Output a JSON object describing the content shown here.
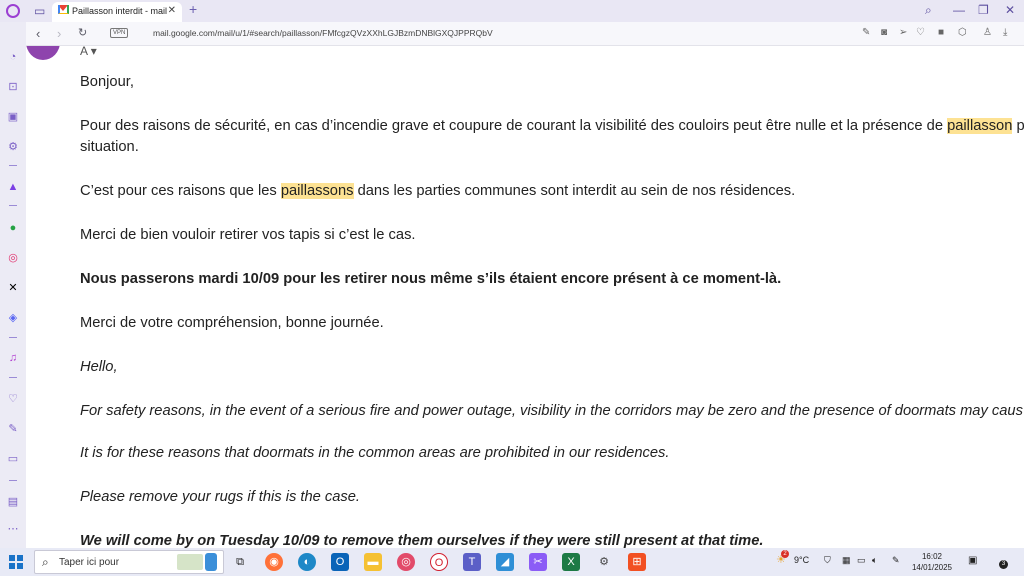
{
  "browser": {
    "tab_title": "Paillasson interdit - mail go",
    "new_tab_symbol": "+",
    "tab_close_symbol": "✕",
    "url": "mail.google.com/mail/u/1/#search/paillasson/FMfcgzQVzXXhLGJBzmDNBlGXQJPPRQbV",
    "vpn_label": "VPN"
  },
  "email": {
    "sender_initial": "A",
    "greeting": "Bonjour,",
    "p1_before": "Pour des raisons de sécurité, en cas d’incendie grave et coupure de courant la visibilité des couloirs peut être nulle et la présence de ",
    "p1_highlight": "paillasson",
    "p1_after": " p",
    "p1_line2": "situation.",
    "p2_before": "C’est pour ces raisons que les ",
    "p2_highlight": "paillassons",
    "p2_after": " dans les parties communes sont interdit au sein de nos résidences.",
    "p3": "Merci de bien vouloir retirer vos tapis si c’est le cas.",
    "p4": "Nous passerons mardi 10/09 pour les retirer nous même s’ils étaient encore présent à ce moment-là.",
    "p5": "Merci de votre compréhension, bonne journée.",
    "en_greeting": "Hello,",
    "en_p1": "For safety reasons, in the event of a serious fire and power outage, visibility in the corridors may be zero and the presence of doormats may caus",
    "en_p2": "It is for these reasons that doormats in the common areas are prohibited in our residences.",
    "en_p3": "Please remove your rugs if this is the case.",
    "en_p4": "We will come by on Tuesday 10/09 to remove them ourselves if they were still present at that time."
  },
  "taskbar": {
    "search_placeholder": "Taper ici pour",
    "weather": "9°C",
    "weather_badge": "2",
    "time": "16:02",
    "date": "14/01/2025",
    "notification_count": "3"
  },
  "colors": {
    "highlight": "#fde293",
    "accent": "#7a5fc6",
    "avatar": "#8e44ad"
  }
}
